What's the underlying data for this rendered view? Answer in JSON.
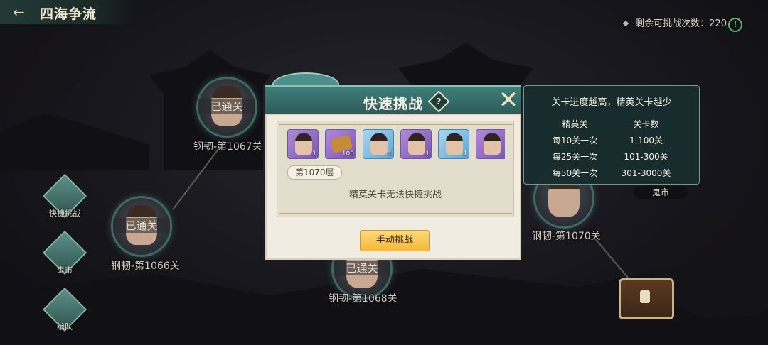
{
  "header": {
    "title": "四海争流"
  },
  "attempts": {
    "label": "剩余可挑战次数：220"
  },
  "stages": [
    {
      "status": "已通关",
      "label": "钢韧-第1067关"
    },
    {
      "status": "已通关",
      "label": "钢韧-第1066关"
    },
    {
      "status": "已通关",
      "label": "钢韧-第1068关"
    },
    {
      "status": "",
      "label": "钢韧-第1070关"
    }
  ],
  "side_menu": [
    {
      "label": "快捷挑战",
      "icon": "quick-challenge-icon"
    },
    {
      "label": "鬼市",
      "icon": "ghost-market-icon"
    },
    {
      "label": "编队",
      "icon": "formation-icon"
    }
  ],
  "ghost_market_label": "鬼市",
  "dialog": {
    "title": "快速挑战",
    "help": "?",
    "rewards": [
      {
        "kind": "portrait",
        "rarity": "purple",
        "count": "1"
      },
      {
        "kind": "scroll",
        "rarity": "purple",
        "count": "100"
      },
      {
        "kind": "portrait",
        "rarity": "blue",
        "count": "1"
      },
      {
        "kind": "portrait",
        "rarity": "purple",
        "count": "1"
      },
      {
        "kind": "portrait",
        "rarity": "blue",
        "count": "1"
      },
      {
        "kind": "portrait",
        "rarity": "purple",
        "count": ""
      }
    ],
    "floor": "第1070层",
    "message": "精英关卡无法快捷挑战",
    "manual_button": "手动挑战"
  },
  "tooltip": {
    "heading": "关卡进度越高，精英关卡越少",
    "columns": [
      "精英关",
      "关卡数"
    ],
    "rows": [
      [
        "每10关一次",
        "1-100关"
      ],
      [
        "每25关一次",
        "101-300关"
      ],
      [
        "每50关一次",
        "301-3000关"
      ]
    ]
  }
}
